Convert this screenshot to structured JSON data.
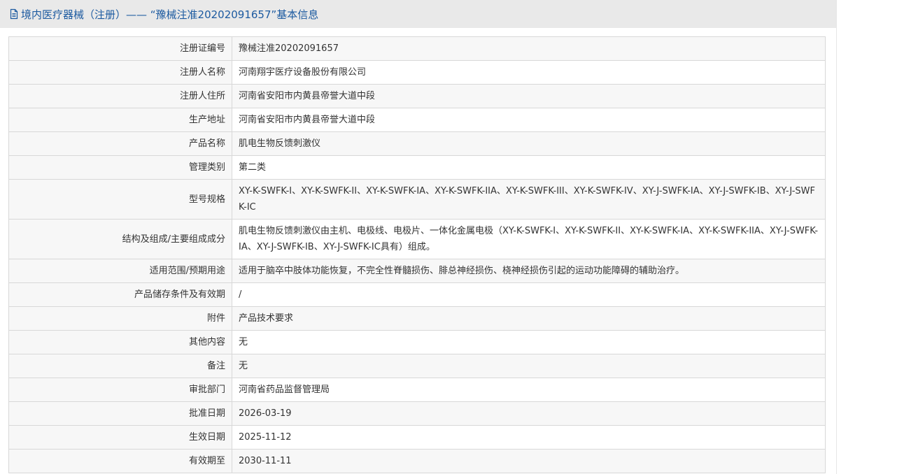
{
  "header": {
    "title": "境内医疗器械（注册）——  “豫械注准20202091657”基本信息",
    "icon": "document-icon"
  },
  "colors": {
    "title": "#1c5aa0",
    "header_bg": "#e9e9e9",
    "label_bg": "#f7f7f7",
    "border": "#d8d8d8"
  },
  "rows": [
    {
      "key": "registration-number",
      "label": "注册证编号",
      "value": "豫械注准20202091657"
    },
    {
      "key": "registrant-name",
      "label": "注册人名称",
      "value": "河南翔宇医疗设备股份有限公司"
    },
    {
      "key": "registrant-address",
      "label": "注册人住所",
      "value": "河南省安阳市内黄县帝誉大道中段"
    },
    {
      "key": "production-address",
      "label": "生产地址",
      "value": "河南省安阳市内黄县帝誉大道中段"
    },
    {
      "key": "product-name",
      "label": "产品名称",
      "value": "肌电生物反馈刺激仪"
    },
    {
      "key": "management-category",
      "label": "管理类别",
      "value": "第二类"
    },
    {
      "key": "model-spec",
      "label": "型号规格",
      "value": "XY-K-SWFK-I、XY-K-SWFK-II、XY-K-SWFK-IA、XY-K-SWFK-IIA、XY-K-SWFK-III、XY-K-SWFK-IV、XY-J-SWFK-IA、XY-J-SWFK-IB、XY-J-SWFK-IC",
      "tall": true
    },
    {
      "key": "structure-composition",
      "label": "结构及组成/主要组成成分",
      "value": "肌电生物反馈刺激仪由主机、电极线、电极片、一体化金属电极（XY-K-SWFK-I、XY-K-SWFK-II、XY-K-SWFK-IA、XY-K-SWFK-IIA、XY-J-SWFK-IA、XY-J-SWFK-IB、XY-J-SWFK-IC具有）组成。",
      "tall": true
    },
    {
      "key": "intended-use",
      "label": "适用范围/预期用途",
      "value": "适用于脑卒中肢体功能恢复，不完全性脊髓损伤、腓总神经损伤、桡神经损伤引起的运动功能障碍的辅助治疗。"
    },
    {
      "key": "storage-validity",
      "label": "产品储存条件及有效期",
      "value": "/"
    },
    {
      "key": "attachment",
      "label": "附件",
      "value": "产品技术要求"
    },
    {
      "key": "other-content",
      "label": "其他内容",
      "value": "无"
    },
    {
      "key": "remarks",
      "label": "备注",
      "value": "无"
    },
    {
      "key": "approval-department",
      "label": "审批部门",
      "value": "河南省药品监督管理局"
    },
    {
      "key": "approval-date",
      "label": "批准日期",
      "value": "2026-03-19"
    },
    {
      "key": "effective-date",
      "label": "生效日期",
      "value": "2025-11-12"
    },
    {
      "key": "valid-until",
      "label": "有效期至",
      "value": "2030-11-11"
    }
  ]
}
